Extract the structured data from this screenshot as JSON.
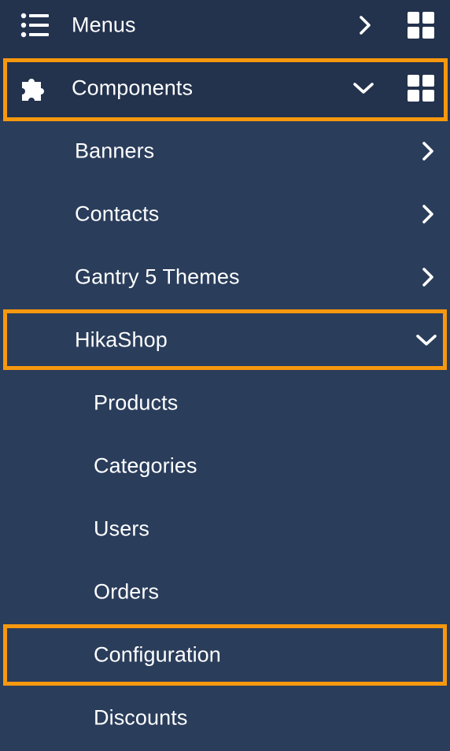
{
  "menu": {
    "menus": {
      "label": "Menus",
      "icon": "list-icon"
    },
    "components": {
      "label": "Components",
      "icon": "puzzle-icon"
    },
    "component_items": [
      {
        "label": "Banners"
      },
      {
        "label": "Contacts"
      },
      {
        "label": "Gantry 5 Themes"
      },
      {
        "label": "HikaShop"
      }
    ],
    "hikashop_items": [
      {
        "label": "Products"
      },
      {
        "label": "Categories"
      },
      {
        "label": "Users"
      },
      {
        "label": "Orders"
      },
      {
        "label": "Configuration"
      },
      {
        "label": "Discounts"
      }
    ]
  },
  "colors": {
    "background": "#2a3d5b",
    "top_level_background": "#23324d",
    "highlight": "#f7980f",
    "text": "#ffffff"
  }
}
